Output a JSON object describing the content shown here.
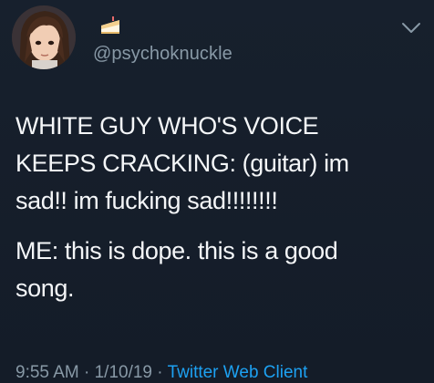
{
  "user": {
    "handle": "@psychoknuckle",
    "avatar_icon": "avatar-anime-girl",
    "badge_icon": "birthday-cake-icon"
  },
  "tweet": {
    "paragraphs": [
      "WHITE GUY WHO'S VOICE\nKEEPS CRACKING: (guitar) im\nsad!! im fucking sad!!!!!!!!",
      "ME: this is dope. this is a good\nsong."
    ]
  },
  "meta": {
    "time": "9:55 AM",
    "date": "1/10/19",
    "separator": "·",
    "client": "Twitter Web Client"
  },
  "menu": {
    "icon": "chevron-down-icon"
  },
  "colors": {
    "background": "#141d2a",
    "text": "#f4f6f8",
    "secondary": "#8899a6",
    "link": "#1da1f2"
  }
}
